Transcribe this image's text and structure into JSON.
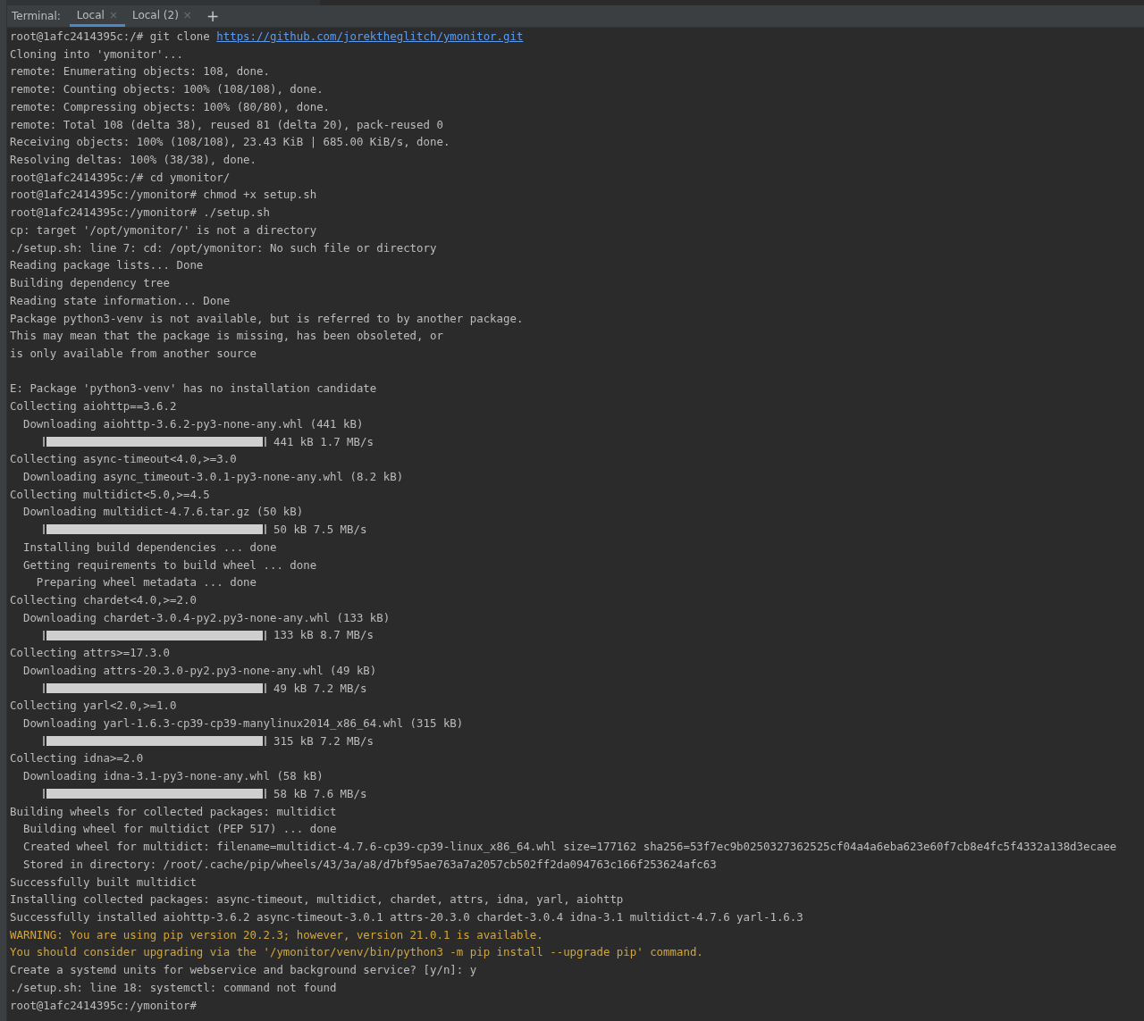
{
  "toolbar": {
    "title": "Terminal:",
    "tabs": [
      {
        "label": "Local",
        "close": "×",
        "selected": true
      },
      {
        "label": "Local (2)",
        "close": "×",
        "selected": false
      }
    ],
    "add": "+"
  },
  "lines": [
    {
      "kind": "command",
      "text": "root@1afc2414395c:/# git clone ",
      "link": "https://github.com/jorektheglitch/ymonitor.git"
    },
    {
      "kind": "text",
      "text": "Cloning into 'ymonitor'..."
    },
    {
      "kind": "text",
      "text": "remote: Enumerating objects: 108, done."
    },
    {
      "kind": "text",
      "text": "remote: Counting objects: 100% (108/108), done."
    },
    {
      "kind": "text",
      "text": "remote: Compressing objects: 100% (80/80), done."
    },
    {
      "kind": "text",
      "text": "remote: Total 108 (delta 38), reused 81 (delta 20), pack-reused 0"
    },
    {
      "kind": "text",
      "text": "Receiving objects: 100% (108/108), 23.43 KiB | 685.00 KiB/s, done."
    },
    {
      "kind": "text",
      "text": "Resolving deltas: 100% (38/38), done."
    },
    {
      "kind": "text",
      "text": "root@1afc2414395c:/# cd ymonitor/"
    },
    {
      "kind": "text",
      "text": "root@1afc2414395c:/ymonitor# chmod +x setup.sh"
    },
    {
      "kind": "text",
      "text": "root@1afc2414395c:/ymonitor# ./setup.sh"
    },
    {
      "kind": "text",
      "text": "cp: target '/opt/ymonitor/' is not a directory"
    },
    {
      "kind": "text",
      "text": "./setup.sh: line 7: cd: /opt/ymonitor: No such file or directory"
    },
    {
      "kind": "text",
      "text": "Reading package lists... Done"
    },
    {
      "kind": "text",
      "text": "Building dependency tree"
    },
    {
      "kind": "text",
      "text": "Reading state information... Done"
    },
    {
      "kind": "text",
      "text": "Package python3-venv is not available, but is referred to by another package."
    },
    {
      "kind": "text",
      "text": "This may mean that the package is missing, has been obsoleted, or"
    },
    {
      "kind": "text",
      "text": "is only available from another source"
    },
    {
      "kind": "blank"
    },
    {
      "kind": "text",
      "text": "E: Package 'python3-venv' has no installation candidate"
    },
    {
      "kind": "text",
      "text": "Collecting aiohttp==3.6.2"
    },
    {
      "kind": "text",
      "text": "  Downloading aiohttp-3.6.2-py3-none-any.whl (441 kB)"
    },
    {
      "kind": "progress",
      "level": 1,
      "text": "441 kB 1.7 MB/s"
    },
    {
      "kind": "text",
      "text": "Collecting async-timeout<4.0,>=3.0"
    },
    {
      "kind": "text",
      "text": "  Downloading async_timeout-3.0.1-py3-none-any.whl (8.2 kB)"
    },
    {
      "kind": "text",
      "text": "Collecting multidict<5.0,>=4.5"
    },
    {
      "kind": "text",
      "text": "  Downloading multidict-4.7.6.tar.gz (50 kB)"
    },
    {
      "kind": "progress",
      "level": 1,
      "text": "50 kB 7.5 MB/s"
    },
    {
      "kind": "text",
      "text": "  Installing build dependencies ... done"
    },
    {
      "kind": "text",
      "text": "  Getting requirements to build wheel ... done"
    },
    {
      "kind": "text",
      "text": "    Preparing wheel metadata ... done"
    },
    {
      "kind": "text",
      "text": "Collecting chardet<4.0,>=2.0"
    },
    {
      "kind": "text",
      "text": "  Downloading chardet-3.0.4-py2.py3-none-any.whl (133 kB)"
    },
    {
      "kind": "progress",
      "level": 1,
      "text": "133 kB 8.7 MB/s"
    },
    {
      "kind": "text",
      "text": "Collecting attrs>=17.3.0"
    },
    {
      "kind": "text",
      "text": "  Downloading attrs-20.3.0-py2.py3-none-any.whl (49 kB)"
    },
    {
      "kind": "progress",
      "level": 1,
      "text": "49 kB 7.2 MB/s"
    },
    {
      "kind": "text",
      "text": "Collecting yarl<2.0,>=1.0"
    },
    {
      "kind": "text",
      "text": "  Downloading yarl-1.6.3-cp39-cp39-manylinux2014_x86_64.whl (315 kB)"
    },
    {
      "kind": "progress",
      "level": 1,
      "text": "315 kB 7.2 MB/s"
    },
    {
      "kind": "text",
      "text": "Collecting idna>=2.0"
    },
    {
      "kind": "text",
      "text": "  Downloading idna-3.1-py3-none-any.whl (58 kB)"
    },
    {
      "kind": "progress",
      "level": 1,
      "text": "58 kB 7.6 MB/s"
    },
    {
      "kind": "text",
      "text": "Building wheels for collected packages: multidict"
    },
    {
      "kind": "text",
      "text": "  Building wheel for multidict (PEP 517) ... done"
    },
    {
      "kind": "text",
      "text": "  Created wheel for multidict: filename=multidict-4.7.6-cp39-cp39-linux_x86_64.whl size=177162 sha256=53f7ec9b0250327362525cf04a4a6eba623e60f7cb8e4fc5f4332a138d3ecaee"
    },
    {
      "kind": "text",
      "text": "  Stored in directory: /root/.cache/pip/wheels/43/3a/a8/d7bf95ae763a7a2057cb502ff2da094763c166f253624afc63"
    },
    {
      "kind": "text",
      "text": "Successfully built multidict"
    },
    {
      "kind": "text",
      "text": "Installing collected packages: async-timeout, multidict, chardet, attrs, idna, yarl, aiohttp"
    },
    {
      "kind": "text",
      "text": "Successfully installed aiohttp-3.6.2 async-timeout-3.0.1 attrs-20.3.0 chardet-3.0.4 idna-3.1 multidict-4.7.6 yarl-1.6.3"
    },
    {
      "kind": "warning",
      "text": "WARNING: You are using pip version 20.2.3; however, version 21.0.1 is available."
    },
    {
      "kind": "warning",
      "text": "You should consider upgrading via the '/ymonitor/venv/bin/python3 -m pip install --upgrade pip' command."
    },
    {
      "kind": "text",
      "text": "Create a systemd units for webservice and background service? [y/n]: y"
    },
    {
      "kind": "text",
      "text": "./setup.sh: line 18: systemctl: command not found"
    },
    {
      "kind": "text",
      "text": "root@1afc2414395c:/ymonitor#"
    }
  ]
}
